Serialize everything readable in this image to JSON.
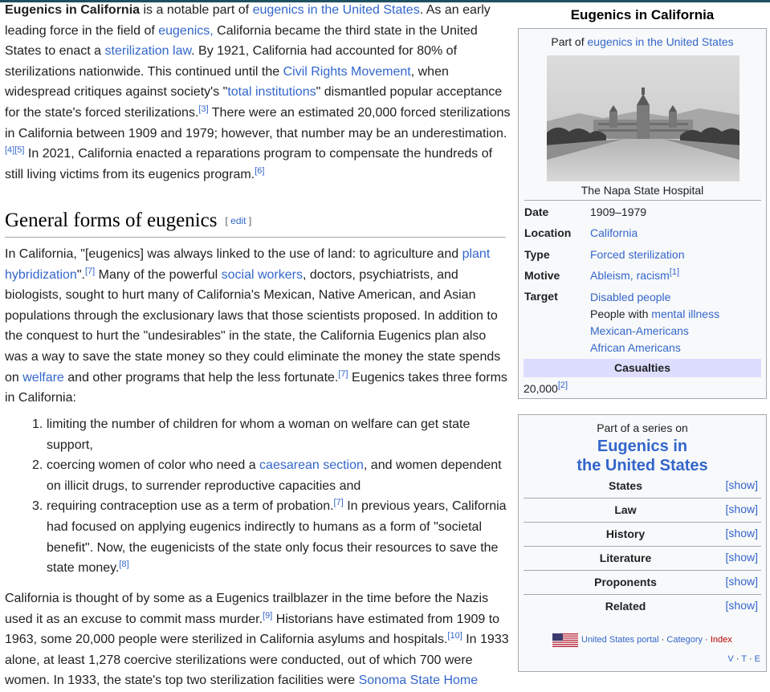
{
  "article": {
    "intro": {
      "bold": "Eugenics in California",
      "t1": " is a notable part of ",
      "l1": "eugenics in the United States",
      "t2": ". As an early leading force in the field of ",
      "l2": "eugenics,",
      "t3": " California became the third state in the United States to enact a ",
      "l3": "sterilization law",
      "t4": ". By 1921, California had accounted for 80% of sterilizations nationwide. This continued until the ",
      "l4": "Civil Rights Movement",
      "t5": ", when widespread critiques against society's \"",
      "l5": "total institutions",
      "t6": "\" dismantled popular acceptance for the state's forced sterilizations.",
      "r1": "[3]",
      "t7": " There were an estimated 20,000 forced sterilizations in California between 1909 and 1979; however, that number may be an underestimation.",
      "r2": "[4]",
      "r3": "[5]",
      "t8": " In 2021, California enacted a reparations program to compensate the hundreds of still living victims from its eugenics program.",
      "r4": "[6]"
    },
    "heading": "General forms of eugenics",
    "edit_open": "[ ",
    "edit_label": "edit",
    "edit_close": " ]",
    "p2": {
      "t1": "In California, \"[eugenics] was always linked to the use of land: to agriculture and ",
      "l1": "plant hybridization",
      "t2": "\".",
      "r1": "[7]",
      "t3": " Many of the powerful ",
      "l2": "social workers",
      "t4": ", doctors, psychiatrists, and biologists, sought to hurt many of California's Mexican, Native American, and Asian populations through the exclusionary laws that those scientists proposed. In addition to the conquest to hurt the \"undesirables\" in the state, the California Eugenics plan also was a way to save the state money so they could eliminate the money the state spends on ",
      "l3": "welfare",
      "t5": " and other programs that help the less fortunate.",
      "r2": "[7]",
      "t6": " Eugenics takes three forms in California:"
    },
    "list": [
      {
        "num": "1.",
        "t1": "limiting the number of children for whom a woman on welfare can get state support,"
      },
      {
        "num": "2.",
        "t1": "coercing women of color who need a ",
        "l1": "caesarean section",
        "t2": ", and women dependent on illicit drugs, to surrender reproductive capacities and"
      },
      {
        "num": "3.",
        "t1": "requiring contraception use as a term of probation.",
        "r1": "[7]",
        "t2": " In previous years, California had focused on applying eugenics indirectly to humans as a form of \"societal benefit\". Now, the eugenicists of the state only focus their resources to save the state money.",
        "r2": "[8]"
      }
    ],
    "p3": {
      "t1": "California is thought of by some as a Eugenics trailblazer in the time before the Nazis used it as an excuse to commit mass murder.",
      "r1": "[9]",
      "t2": " Historians have estimated from 1909 to 1963, some 20,000 people were sterilized in California asylums and hospitals.",
      "r2": "[10]",
      "t3": " In 1933 alone, at least 1,278 coercive sterilizations were conducted, out of which 700 were women. In 1933, the state's top two sterilization facilities were ",
      "l1": "Sonoma State Home"
    }
  },
  "infobox": {
    "title": "Eugenics in California",
    "partof_prefix": "Part of ",
    "partof_link": "eugenics in the United States",
    "caption": "The Napa State Hospital",
    "rows": [
      {
        "label": "Date",
        "value": "1909–1979"
      },
      {
        "label": "Location",
        "value": "California"
      },
      {
        "label": "Type",
        "value": "Forced sterilization"
      },
      {
        "label": "Motive",
        "value": "Ableism, racism",
        "ref": "[1]"
      }
    ],
    "target_label": "Target",
    "targets": {
      "t1": "Disabled people",
      "t2_prefix": "People with ",
      "t2_link": "mental illness",
      "t3": "Mexican-Americans",
      "t4": "African Americans"
    },
    "casualties_label": "Casualties",
    "casualties_value": "20,000",
    "casualties_ref": "[2]"
  },
  "series": {
    "pre": "Part of a series on",
    "title_line1": "Eugenics in",
    "title_line2": "the United States",
    "show_label": "[show]",
    "rows": [
      "States",
      "Law",
      "History",
      "Literature",
      "Proponents",
      "Related"
    ],
    "portal": "United States portal",
    "sep": " · ",
    "category": "Category",
    "index": "Index",
    "vte": [
      "V",
      "T",
      "E"
    ]
  }
}
